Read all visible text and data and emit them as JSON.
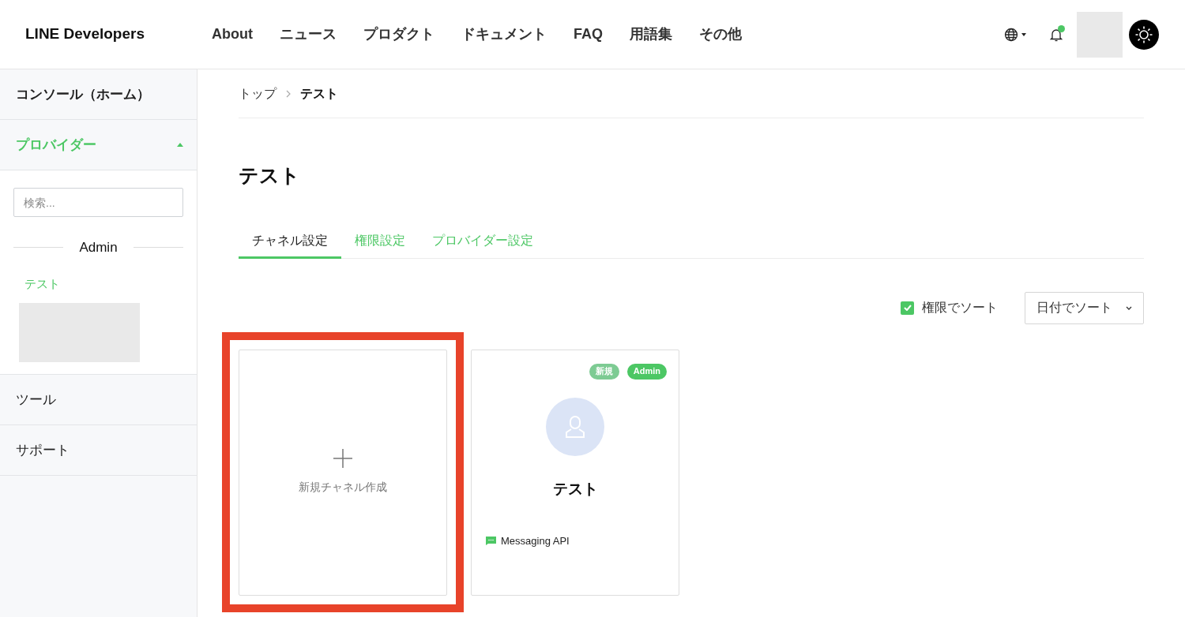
{
  "header": {
    "logo": "LINE Developers",
    "nav": [
      "About",
      "ニュース",
      "プロダクト",
      "ドキュメント",
      "FAQ",
      "用語集",
      "その他"
    ],
    "notification_dot": true
  },
  "sidebar": {
    "items": [
      {
        "label": "コンソール（ホーム）",
        "active": false
      },
      {
        "label": "プロバイダー",
        "active": true,
        "expanded": true,
        "search": {
          "placeholder": "検索..."
        },
        "group": "Admin",
        "providers": [
          "テスト"
        ]
      },
      {
        "label": "ツール",
        "active": false
      },
      {
        "label": "サポート",
        "active": false
      }
    ]
  },
  "breadcrumb": [
    "トップ",
    "テスト"
  ],
  "title": "テスト",
  "tabs": [
    {
      "label": "チャネル設定",
      "selected": true
    },
    {
      "label": "権限設定",
      "selected": false
    },
    {
      "label": "プロバイダー設定",
      "selected": false
    }
  ],
  "sort": {
    "checkbox": {
      "label": "権限でソート",
      "checked": true
    },
    "dropdown": {
      "value": "日付でソート"
    }
  },
  "cards": [
    {
      "kind": "new",
      "label": "新規チャネル作成",
      "highlighted": true
    },
    {
      "kind": "channel",
      "name": "テスト",
      "badges": [
        {
          "label": "新規",
          "color": "#7dcb93"
        },
        {
          "label": "Admin",
          "color": "#4cc764"
        }
      ],
      "type": "Messaging API",
      "highlighted": false
    }
  ]
}
